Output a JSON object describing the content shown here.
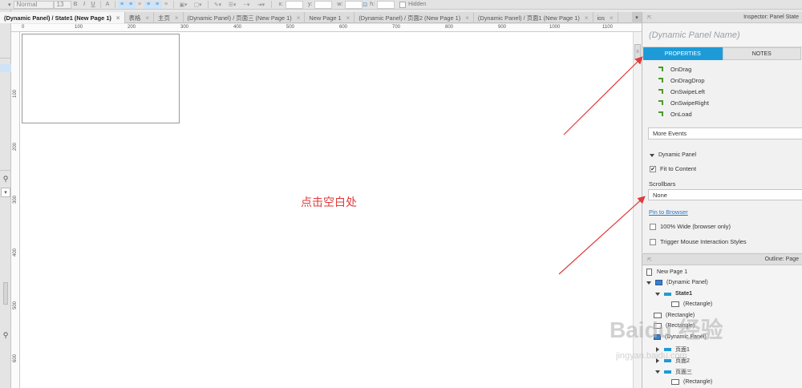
{
  "toolbar": {
    "style_select": "Normal",
    "font_size": "13",
    "bold": "B",
    "italic": "I",
    "underline": "U",
    "x_label": "x:",
    "y_label": "y:",
    "w_label": "w:",
    "h_label": "h:",
    "hidden_label": "Hidden"
  },
  "tabs": [
    {
      "label": "(Dynamic Panel) / State1 (New Page 1)",
      "active": true
    },
    {
      "label": "表格"
    },
    {
      "label": "主页"
    },
    {
      "label": "(Dynamic Panel) / 页面三 (New Page 1)"
    },
    {
      "label": "New Page 1"
    },
    {
      "label": "(Dynamic Panel) / 页面2 (New Page 1)"
    },
    {
      "label": "(Dynamic Panel) / 页面1 (New Page 1)"
    },
    {
      "label": "ios"
    }
  ],
  "ruler": {
    "h_ticks": [
      "0",
      "100",
      "200",
      "300",
      "400",
      "500",
      "600",
      "700",
      "800",
      "900",
      "1000",
      "1100"
    ],
    "v_ticks": [
      "100",
      "200",
      "300",
      "400",
      "500",
      "600"
    ]
  },
  "canvas": {
    "annotation": "点击空白处"
  },
  "inspector": {
    "title": "Inspector: Panel State",
    "name_placeholder": "(Dynamic Panel Name)",
    "tab_properties": "PROPERTIES",
    "tab_notes": "NOTES",
    "events": [
      "OnDrag",
      "OnDragDrop",
      "OnSwipeLeft",
      "OnSwipeRight",
      "OnLoad"
    ],
    "more_events": "More Events",
    "section_dynamic_panel": "Dynamic Panel",
    "fit_to_content": "Fit to Content",
    "scrollbars_label": "Scrollbars",
    "scrollbars_value": "None",
    "pin_to_browser": "Pin to Browser",
    "wide_label": "100% Wide (browser only)",
    "trigger_label": "Trigger Mouse Interaction Styles"
  },
  "outline": {
    "title": "Outline: Page",
    "items": [
      {
        "label": "New Page 1",
        "icon": "page-icon"
      },
      {
        "label": "(Dynamic Panel)",
        "icon": "dynamic-panel-icon"
      },
      {
        "label": "State1",
        "icon": "state-icon"
      },
      {
        "label": "(Rectangle)",
        "icon": "rectangle-icon"
      },
      {
        "label": "(Rectangle)",
        "icon": "rectangle-icon"
      },
      {
        "label": "(Rectangle)",
        "icon": "rectangle-icon"
      },
      {
        "label": "(Dynamic Panel)",
        "icon": "dynamic-panel-icon"
      },
      {
        "label": "页面1",
        "icon": "state-icon"
      },
      {
        "label": "页面2",
        "icon": "state-icon"
      },
      {
        "label": "页面三",
        "icon": "state-icon"
      },
      {
        "label": "(Rectangle)",
        "icon": "rectangle-icon"
      }
    ]
  },
  "watermark": {
    "main": "Baidu 经验",
    "sub": "jingyan.baidu.com"
  },
  "colors": {
    "accent": "#1e9bd7",
    "annotation": "#e03b3b",
    "event_icon": "#4c9a2a"
  }
}
